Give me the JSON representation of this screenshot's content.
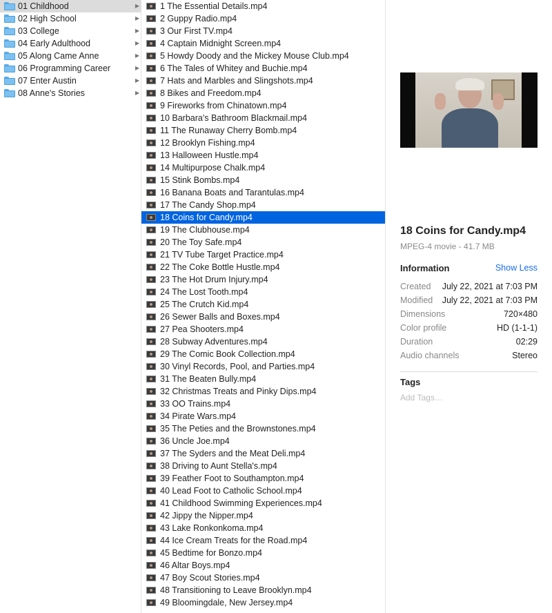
{
  "folders": [
    {
      "label": "01 Childhood",
      "selected": true
    },
    {
      "label": "02 High School",
      "selected": false
    },
    {
      "label": "03 College",
      "selected": false
    },
    {
      "label": "04 Early Adulthood",
      "selected": false
    },
    {
      "label": "05 Along Came Anne",
      "selected": false
    },
    {
      "label": "06 Programming Career",
      "selected": false
    },
    {
      "label": "07 Enter Austin",
      "selected": false
    },
    {
      "label": "08 Anne's Stories",
      "selected": false
    }
  ],
  "files": [
    "1 The Essential Details.mp4",
    "2 Guppy Radio.mp4",
    "3 Our First TV.mp4",
    "4 Captain Midnight Screen.mp4",
    "5 Howdy Doody and the Mickey Mouse Club.mp4",
    "6 The Tales of Whitey and Buchie.mp4",
    "7 Hats and Marbles and Slingshots.mp4",
    "8 Bikes and Freedom.mp4",
    "9 Fireworks from Chinatown.mp4",
    "10 Barbara's Bathroom Blackmail.mp4",
    "11 The Runaway Cherry Bomb.mp4",
    "12 Brooklyn Fishing.mp4",
    "13 Halloween Hustle.mp4",
    "14 Multipurpose Chalk.mp4",
    "15 Stink Bombs.mp4",
    "16 Banana Boats and Tarantulas.mp4",
    "17 The Candy Shop.mp4",
    "18 Coins for Candy.mp4",
    "19 The Clubhouse.mp4",
    "20 The Toy Safe.mp4",
    "21 TV Tube Target Practice.mp4",
    "22 The Coke Bottle Hustle.mp4",
    "23 The Hot Drum Injury.mp4",
    "24 The Lost Tooth.mp4",
    "25 The Crutch Kid.mp4",
    "26 Sewer Balls and Boxes.mp4",
    "27 Pea Shooters.mp4",
    "28 Subway Adventures.mp4",
    "29 The Comic Book Collection.mp4",
    "30 Vinyl Records, Pool, and Parties.mp4",
    "31 The Beaten Bully.mp4",
    "32 Christmas Treats and Pinky Dips.mp4",
    "33 OO Trains.mp4",
    "34 Pirate Wars.mp4",
    "35 The Peties and the Brownstones.mp4",
    "36 Uncle Joe.mp4",
    "37 The Syders and the Meat Deli.mp4",
    "38 Driving to Aunt Stella's.mp4",
    "39 Feather Foot to Southampton.mp4",
    "40 Lead Foot to Catholic School.mp4",
    "41 Childhood Swimming Experiences.mp4",
    "42 Jippy the Nipper.mp4",
    "43 Lake Ronkonkoma.mp4",
    "44 Ice Cream Treats for the Road.mp4",
    "45 Bedtime for Bonzo.mp4",
    "46 Altar Boys.mp4",
    "47 Boy Scout Stories.mp4",
    "48 Transitioning to Leave Brooklyn.mp4",
    "49 Bloomingdale, New Jersey.mp4"
  ],
  "selected_file_index": 17,
  "preview": {
    "filename": "18 Coins for Candy.mp4",
    "kind": "MPEG-4 movie - 41.7 MB",
    "info_heading": "Information",
    "show_less": "Show Less",
    "info": [
      {
        "key": "Created",
        "value": "July 22, 2021 at 7:03 PM"
      },
      {
        "key": "Modified",
        "value": "July 22, 2021 at 7:03 PM"
      },
      {
        "key": "Dimensions",
        "value": "720×480"
      },
      {
        "key": "Color profile",
        "value": "HD (1-1-1)"
      },
      {
        "key": "Duration",
        "value": "02:29"
      },
      {
        "key": "Audio channels",
        "value": "Stereo"
      }
    ],
    "tags_heading": "Tags",
    "tags_placeholder": "Add Tags…"
  },
  "colors": {
    "selection": "#0064e0",
    "folder": "#7cc1f2",
    "link": "#1a6ee8"
  }
}
